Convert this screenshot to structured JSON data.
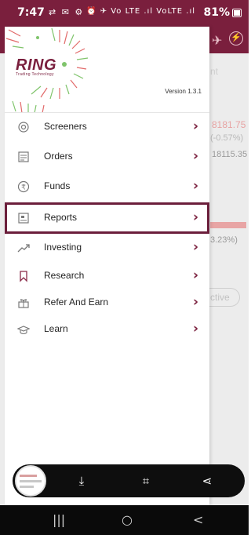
{
  "status_bar": {
    "time": "7:47",
    "left_icons": "⇄ ✉ ⚙ d",
    "right_icons": "⏰ ✈ Vo LTE .ıl VoLTE .ıl",
    "battery": "81%"
  },
  "background_app": {
    "tab_hint": "nt",
    "value1": "8181.75",
    "value2": "(-0.57%)",
    "value3": "18115.35",
    "value4": "3.23%)",
    "pill_label": "ctive"
  },
  "drawer": {
    "logo": "RING",
    "logo_subtitle": "Trading Technology",
    "version": "Version 1.3.1",
    "menu": [
      {
        "label": "Screeners",
        "icon": "screener-icon"
      },
      {
        "label": "Orders",
        "icon": "orders-icon"
      },
      {
        "label": "Funds",
        "icon": "rupee-icon"
      },
      {
        "label": "Reports",
        "icon": "report-icon"
      },
      {
        "label": "Investing",
        "icon": "chart-up-icon"
      },
      {
        "label": "Research",
        "icon": "bookmark-icon"
      },
      {
        "label": "Refer And Earn",
        "icon": "gift-icon"
      },
      {
        "label": "Learn",
        "icon": "graduation-cap-icon"
      }
    ],
    "highlighted_item": "Reports"
  },
  "toolbar": {
    "items": [
      "screenshot-thumbnail",
      "scroll-capture-icon",
      "crop-edit-icon",
      "share-icon"
    ]
  },
  "nav_bar": {
    "recent": "|||",
    "home": "○",
    "back": "<"
  },
  "colors": {
    "brand": "#7a1f3d",
    "highlight_border": "#6b1e3b"
  }
}
